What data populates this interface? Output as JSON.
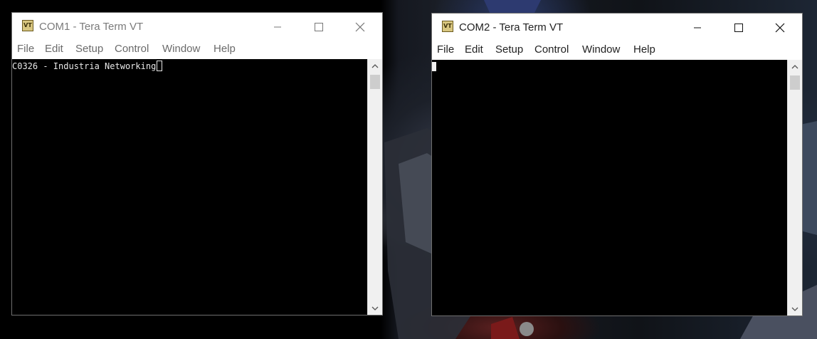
{
  "windows": [
    {
      "title": "COM1 - Tera Term VT",
      "icon_text": "VT",
      "menu": [
        "File",
        "Edit",
        "Setup",
        "Control",
        "Window",
        "Help"
      ],
      "terminal_text": "C0326 - Industria Networking",
      "focused": false
    },
    {
      "title": "COM2 - Tera Term VT",
      "icon_text": "VT",
      "menu": [
        "File",
        "Edit",
        "Setup",
        "Control",
        "Window",
        "Help"
      ],
      "terminal_text": "",
      "focused": true
    }
  ],
  "icons": {
    "minimize": "minimize-icon",
    "maximize": "maximize-icon",
    "close": "close-icon",
    "scroll_up": "chevron-up-icon",
    "scroll_down": "chevron-down-icon"
  }
}
